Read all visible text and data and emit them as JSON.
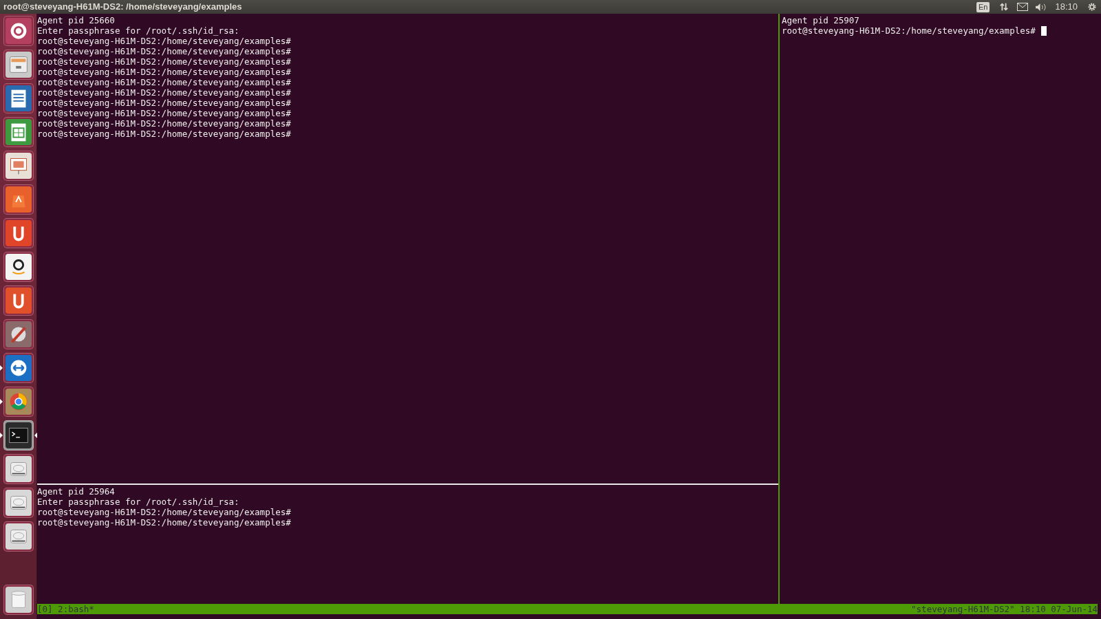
{
  "top_bar": {
    "title": "root@steveyang-H61M-DS2: /home/steveyang/examples",
    "keyboard_layout": "En",
    "clock": "18:10"
  },
  "launcher": {
    "items": [
      {
        "kind": "dash",
        "running": false,
        "focused": false
      },
      {
        "kind": "files",
        "running": false,
        "focused": false
      },
      {
        "kind": "writer",
        "running": false,
        "focused": false
      },
      {
        "kind": "calc",
        "running": false,
        "focused": false
      },
      {
        "kind": "impress",
        "running": false,
        "focused": false
      },
      {
        "kind": "store",
        "running": false,
        "focused": false
      },
      {
        "kind": "ubuntu-one",
        "running": false,
        "focused": false
      },
      {
        "kind": "amazon",
        "running": false,
        "focused": false
      },
      {
        "kind": "music",
        "running": false,
        "focused": false
      },
      {
        "kind": "settings",
        "running": false,
        "focused": false
      },
      {
        "kind": "remote",
        "running": true,
        "focused": false
      },
      {
        "kind": "browser",
        "running": true,
        "focused": false
      },
      {
        "kind": "terminal",
        "running": true,
        "focused": true
      },
      {
        "kind": "drive",
        "running": false,
        "focused": false
      },
      {
        "kind": "drive",
        "running": false,
        "focused": false
      },
      {
        "kind": "drive",
        "running": false,
        "focused": false
      }
    ],
    "trash": {
      "kind": "trash"
    }
  },
  "panes": {
    "top_left": {
      "lines": [
        "Agent pid 25660",
        "Enter passphrase for /root/.ssh/id_rsa:",
        "root@steveyang-H61M-DS2:/home/steveyang/examples#",
        "root@steveyang-H61M-DS2:/home/steveyang/examples#",
        "root@steveyang-H61M-DS2:/home/steveyang/examples#",
        "root@steveyang-H61M-DS2:/home/steveyang/examples#",
        "root@steveyang-H61M-DS2:/home/steveyang/examples#",
        "root@steveyang-H61M-DS2:/home/steveyang/examples#",
        "root@steveyang-H61M-DS2:/home/steveyang/examples#",
        "root@steveyang-H61M-DS2:/home/steveyang/examples#",
        "root@steveyang-H61M-DS2:/home/steveyang/examples#",
        "root@steveyang-H61M-DS2:/home/steveyang/examples#"
      ],
      "cursor": false
    },
    "bottom_left": {
      "lines": [
        "Agent pid 25964",
        "Enter passphrase for /root/.ssh/id_rsa:",
        "root@steveyang-H61M-DS2:/home/steveyang/examples#",
        "root@steveyang-H61M-DS2:/home/steveyang/examples#"
      ],
      "cursor": false
    },
    "right": {
      "lines": [
        "Agent pid 25907",
        "root@steveyang-H61M-DS2:/home/steveyang/examples#"
      ],
      "cursor": true
    }
  },
  "status_bar": {
    "session": "[0] 2:bash*",
    "host_time": "\"steveyang-H61M-DS2\" 18:10 07-Jun-14"
  }
}
